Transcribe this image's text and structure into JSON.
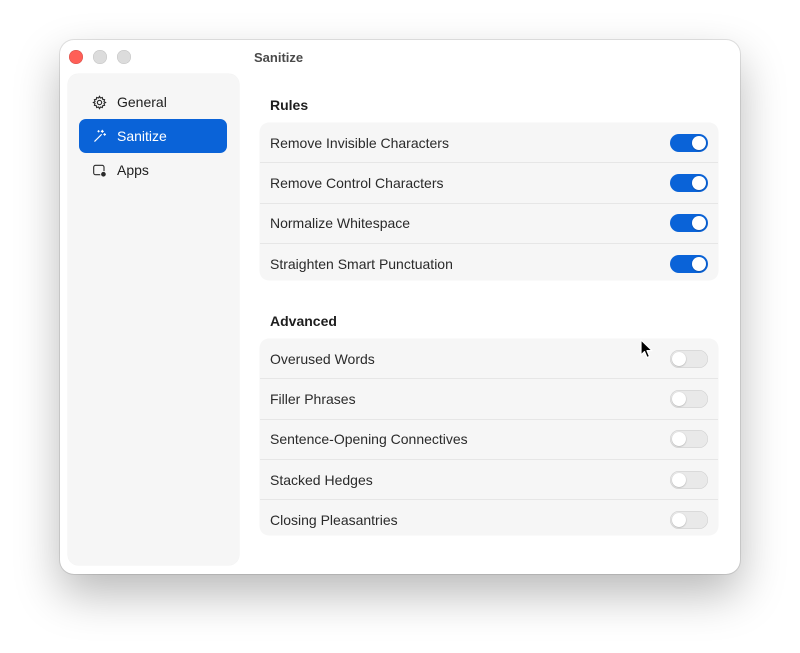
{
  "window": {
    "title": "Sanitize"
  },
  "sidebar": {
    "items": [
      {
        "label": "General",
        "icon": "gear-icon",
        "active": false
      },
      {
        "label": "Sanitize",
        "icon": "magic-wand-icon",
        "active": true
      },
      {
        "label": "Apps",
        "icon": "app-badge-icon",
        "active": false
      }
    ]
  },
  "main": {
    "rules": {
      "title": "Rules",
      "items": [
        {
          "label": "Remove Invisible Characters",
          "enabled": true
        },
        {
          "label": "Remove Control Characters",
          "enabled": true
        },
        {
          "label": "Normalize Whitespace",
          "enabled": true
        },
        {
          "label": "Straighten Smart Punctuation",
          "enabled": true
        }
      ]
    },
    "advanced": {
      "title": "Advanced",
      "items": [
        {
          "label": "Overused Words",
          "enabled": false
        },
        {
          "label": "Filler Phrases",
          "enabled": false
        },
        {
          "label": "Sentence-Opening Connectives",
          "enabled": false
        },
        {
          "label": "Stacked Hedges",
          "enabled": false
        },
        {
          "label": "Closing Pleasantries",
          "enabled": false
        }
      ]
    }
  },
  "colors": {
    "accent": "#0a63d8",
    "close": "#ff5f57",
    "toggle_off": "#e9e9e9"
  }
}
